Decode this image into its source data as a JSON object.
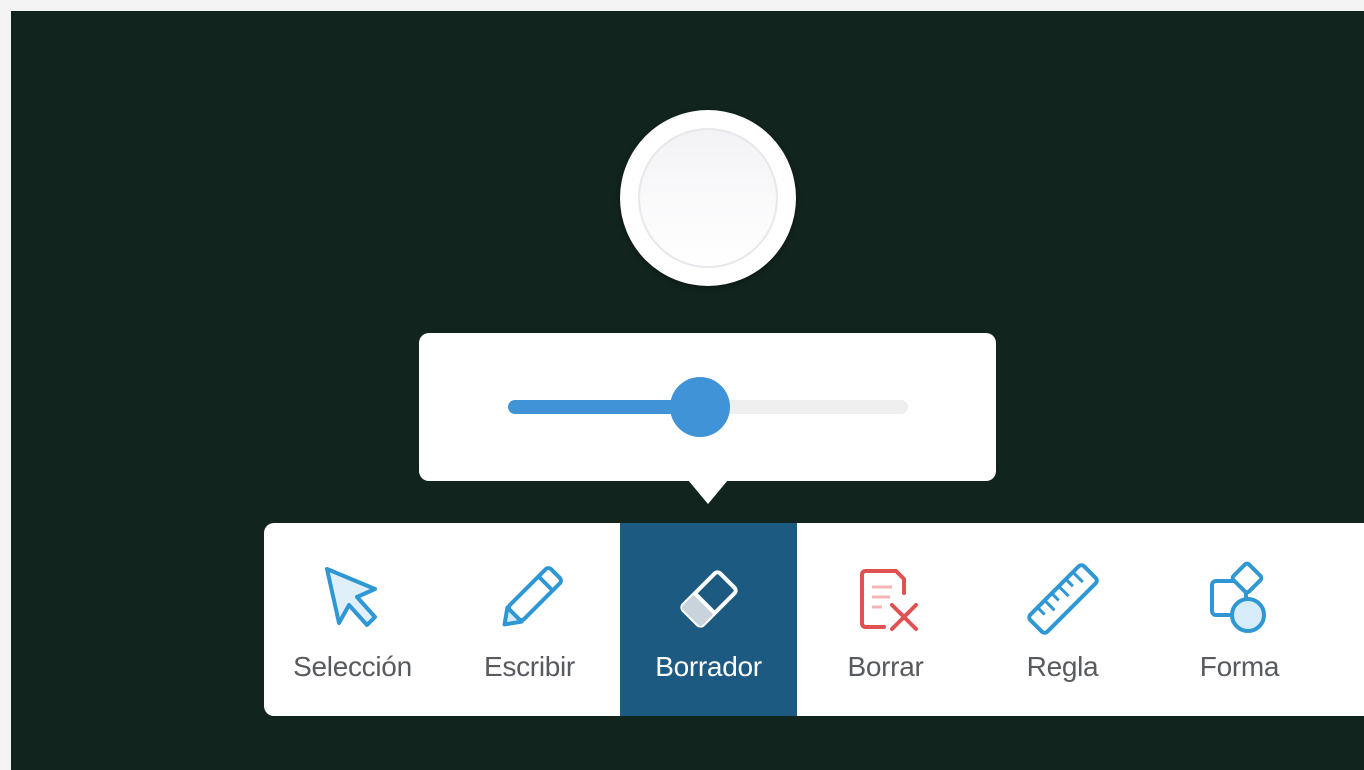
{
  "slider": {
    "value_fraction": 0.48
  },
  "toolbar": {
    "active_tool": "eraser",
    "tools": [
      {
        "id": "selection",
        "label": "Selección",
        "icon": "cursor-arrow-icon"
      },
      {
        "id": "write",
        "label": "Escribir",
        "icon": "pencil-icon"
      },
      {
        "id": "eraser",
        "label": "Borrador",
        "icon": "eraser-icon"
      },
      {
        "id": "clear",
        "label": "Borrar",
        "icon": "clear-page-icon"
      },
      {
        "id": "ruler",
        "label": "Regla",
        "icon": "ruler-icon"
      },
      {
        "id": "shape",
        "label": "Forma",
        "icon": "shapes-icon"
      }
    ]
  },
  "colors": {
    "board": "#11241d",
    "accent": "#3f93d6",
    "active_tool_bg": "#1d5a82",
    "clear_icon": "#e05252"
  }
}
